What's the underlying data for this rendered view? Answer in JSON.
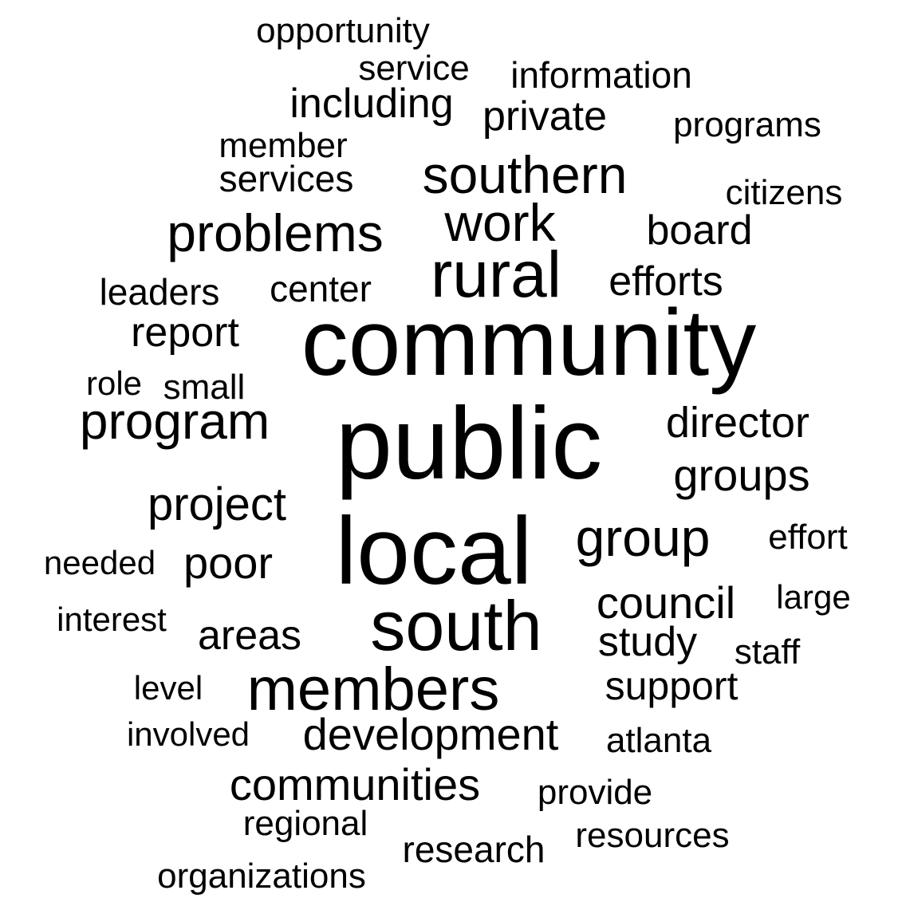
{
  "words": [
    {
      "text": "community",
      "weight": 1.0
    },
    {
      "text": "public",
      "weight": 0.95
    },
    {
      "text": "local",
      "weight": 0.9
    },
    {
      "text": "south",
      "weight": 0.7
    },
    {
      "text": "rural",
      "weight": 0.62
    },
    {
      "text": "members",
      "weight": 0.58
    },
    {
      "text": "southern",
      "weight": 0.55
    },
    {
      "text": "problems",
      "weight": 0.55
    },
    {
      "text": "group",
      "weight": 0.55
    },
    {
      "text": "work",
      "weight": 0.54
    },
    {
      "text": "program",
      "weight": 0.52
    },
    {
      "text": "project",
      "weight": 0.46
    },
    {
      "text": "groups",
      "weight": 0.46
    },
    {
      "text": "council",
      "weight": 0.46
    },
    {
      "text": "director",
      "weight": 0.45
    },
    {
      "text": "development",
      "weight": 0.45
    },
    {
      "text": "communities",
      "weight": 0.45
    },
    {
      "text": "poor",
      "weight": 0.44
    },
    {
      "text": "board",
      "weight": 0.43
    },
    {
      "text": "efforts",
      "weight": 0.43
    },
    {
      "text": "report",
      "weight": 0.42
    },
    {
      "text": "study",
      "weight": 0.42
    },
    {
      "text": "support",
      "weight": 0.41
    },
    {
      "text": "areas",
      "weight": 0.41
    },
    {
      "text": "including",
      "weight": 0.4
    },
    {
      "text": "private",
      "weight": 0.39
    },
    {
      "text": "center",
      "weight": 0.36
    },
    {
      "text": "services",
      "weight": 0.36
    },
    {
      "text": "leaders",
      "weight": 0.36
    },
    {
      "text": "regional",
      "weight": 0.36
    },
    {
      "text": "atlanta",
      "weight": 0.36
    },
    {
      "text": "research",
      "weight": 0.36
    },
    {
      "text": "information",
      "weight": 0.35
    },
    {
      "text": "service",
      "weight": 0.35
    },
    {
      "text": "member",
      "weight": 0.34
    },
    {
      "text": "small",
      "weight": 0.34
    },
    {
      "text": "citizens",
      "weight": 0.34
    },
    {
      "text": "provide",
      "weight": 0.34
    },
    {
      "text": "effort",
      "weight": 0.34
    },
    {
      "text": "programs",
      "weight": 0.33
    },
    {
      "text": "opportunity",
      "weight": 0.33
    },
    {
      "text": "organizations",
      "weight": 0.33
    },
    {
      "text": "resources",
      "weight": 0.33
    },
    {
      "text": "staff",
      "weight": 0.33
    },
    {
      "text": "large",
      "weight": 0.32
    },
    {
      "text": "involved",
      "weight": 0.32
    },
    {
      "text": "interest",
      "weight": 0.31
    },
    {
      "text": "needed",
      "weight": 0.31
    },
    {
      "text": "level",
      "weight": 0.31
    },
    {
      "text": "role",
      "weight": 0.3
    }
  ]
}
